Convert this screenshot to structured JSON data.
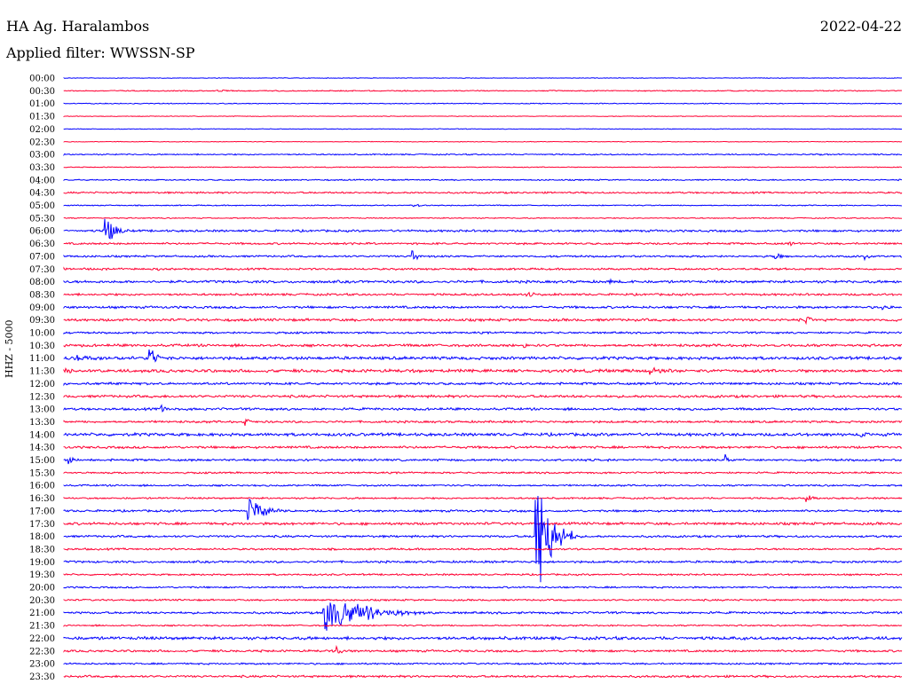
{
  "header": {
    "station": "HA Ag. Haralambos",
    "date": "2022-04-22",
    "filter": "Applied filter: WWSSN-SP",
    "channel": "HHZ - 5000"
  },
  "colors": {
    "odd": "#0000ff",
    "even": "#ff0033"
  },
  "chart_data": {
    "type": "line",
    "title": "HA Ag. Haralambos",
    "subtitle": "Applied filter: WWSSN-SP",
    "ylabel": "HHZ - 5000",
    "categories": [
      "00:00",
      "00:30",
      "01:00",
      "01:30",
      "02:00",
      "02:30",
      "03:00",
      "03:30",
      "04:00",
      "04:30",
      "05:00",
      "05:30",
      "06:00",
      "06:30",
      "07:00",
      "07:30",
      "08:00",
      "08:30",
      "09:00",
      "09:30",
      "10:00",
      "10:30",
      "11:00",
      "11:30",
      "12:00",
      "12:30",
      "13:00",
      "13:30",
      "14:00",
      "14:30",
      "15:00",
      "15:30",
      "16:00",
      "16:30",
      "17:00",
      "17:30",
      "18:00",
      "18:30",
      "19:00",
      "19:30",
      "20:00",
      "20:30",
      "21:00",
      "21:30",
      "22:00",
      "22:30",
      "23:00",
      "23:30"
    ],
    "noise_levels": [
      0.3,
      0.5,
      0.4,
      0.3,
      0.3,
      0.3,
      0.6,
      0.4,
      0.6,
      0.8,
      0.5,
      0.5,
      1.0,
      0.9,
      0.9,
      0.9,
      1.2,
      1.0,
      1.1,
      1.2,
      0.9,
      1.2,
      1.4,
      1.4,
      1.1,
      1.2,
      1.1,
      1.0,
      1.4,
      1.1,
      1.0,
      0.8,
      0.8,
      0.8,
      1.0,
      1.2,
      1.0,
      0.9,
      1.0,
      0.8,
      0.8,
      0.8,
      1.0,
      0.7,
      1.4,
      1.0,
      0.8,
      1.0
    ],
    "events": [
      {
        "row": "00:30",
        "x_min": 5.5,
        "amplitude": 1.6,
        "duration_min": 1.5
      },
      {
        "row": "03:00",
        "x_min": 27.0,
        "amplitude": 1.5,
        "duration_min": 2.0
      },
      {
        "row": "04:00",
        "x_min": 7.0,
        "amplitude": 1.3,
        "duration_min": 1.5
      },
      {
        "row": "05:00",
        "x_min": 12.5,
        "amplitude": 2.0,
        "duration_min": 1.5
      },
      {
        "row": "06:00",
        "x_min": 1.5,
        "amplitude": 20.0,
        "duration_min": 1.0
      },
      {
        "row": "06:30",
        "x_min": 10.0,
        "amplitude": 4.0,
        "duration_min": 1.0
      },
      {
        "row": "06:30",
        "x_min": 26.0,
        "amplitude": 3.5,
        "duration_min": 1.0
      },
      {
        "row": "07:00",
        "x_min": 12.5,
        "amplitude": 9.0,
        "duration_min": 0.6
      },
      {
        "row": "07:00",
        "x_min": 25.5,
        "amplitude": 5.5,
        "duration_min": 0.6
      },
      {
        "row": "07:00",
        "x_min": 28.7,
        "amplitude": 4.0,
        "duration_min": 0.6
      },
      {
        "row": "07:30",
        "x_min": 0.7,
        "amplitude": 2.0,
        "duration_min": 0.8
      },
      {
        "row": "07:30",
        "x_min": 3.4,
        "amplitude": 2.0,
        "duration_min": 0.8
      },
      {
        "row": "08:00",
        "x_min": 19.5,
        "amplitude": 3.5,
        "duration_min": 1.0
      },
      {
        "row": "08:30",
        "x_min": 16.6,
        "amplitude": 4.0,
        "duration_min": 1.5
      },
      {
        "row": "09:00",
        "x_min": 29.3,
        "amplitude": 5.0,
        "duration_min": 0.6
      },
      {
        "row": "09:30",
        "x_min": 26.6,
        "amplitude": 5.0,
        "duration_min": 0.8
      },
      {
        "row": "10:30",
        "x_min": 16.5,
        "amplitude": 5.0,
        "duration_min": 0.4
      },
      {
        "row": "11:00",
        "x_min": 0.5,
        "amplitude": 5.0,
        "duration_min": 2.0
      },
      {
        "row": "11:00",
        "x_min": 3.1,
        "amplitude": 14.0,
        "duration_min": 0.8
      },
      {
        "row": "11:30",
        "x_min": 0.1,
        "amplitude": 5.0,
        "duration_min": 0.8
      },
      {
        "row": "11:30",
        "x_min": 21.0,
        "amplitude": 6.0,
        "duration_min": 2.0
      },
      {
        "row": "12:00",
        "x_min": 21.0,
        "amplitude": 2.5,
        "duration_min": 1.5
      },
      {
        "row": "13:00",
        "x_min": 3.5,
        "amplitude": 6.0,
        "duration_min": 0.6
      },
      {
        "row": "13:30",
        "x_min": 6.5,
        "amplitude": 5.0,
        "duration_min": 0.6
      },
      {
        "row": "14:00",
        "x_min": 28.5,
        "amplitude": 5.0,
        "duration_min": 0.8
      },
      {
        "row": "15:00",
        "x_min": 0.2,
        "amplitude": 6.0,
        "duration_min": 0.6
      },
      {
        "row": "15:00",
        "x_min": 23.7,
        "amplitude": 7.0,
        "duration_min": 0.4
      },
      {
        "row": "16:30",
        "x_min": 26.6,
        "amplitude": 5.0,
        "duration_min": 0.8
      },
      {
        "row": "17:00",
        "x_min": 6.6,
        "amplitude": 20.0,
        "duration_min": 1.5
      },
      {
        "row": "18:00",
        "x_min": 16.9,
        "amplitude": 90.0,
        "duration_min": 1.5
      },
      {
        "row": "21:00",
        "x_min": 9.3,
        "amplitude": 28.0,
        "duration_min": 4.0
      },
      {
        "row": "22:30",
        "x_min": 9.8,
        "amplitude": 5.0,
        "duration_min": 0.6
      },
      {
        "row": "23:00",
        "x_min": 27.0,
        "amplitude": 2.0,
        "duration_min": 0.6
      }
    ]
  }
}
